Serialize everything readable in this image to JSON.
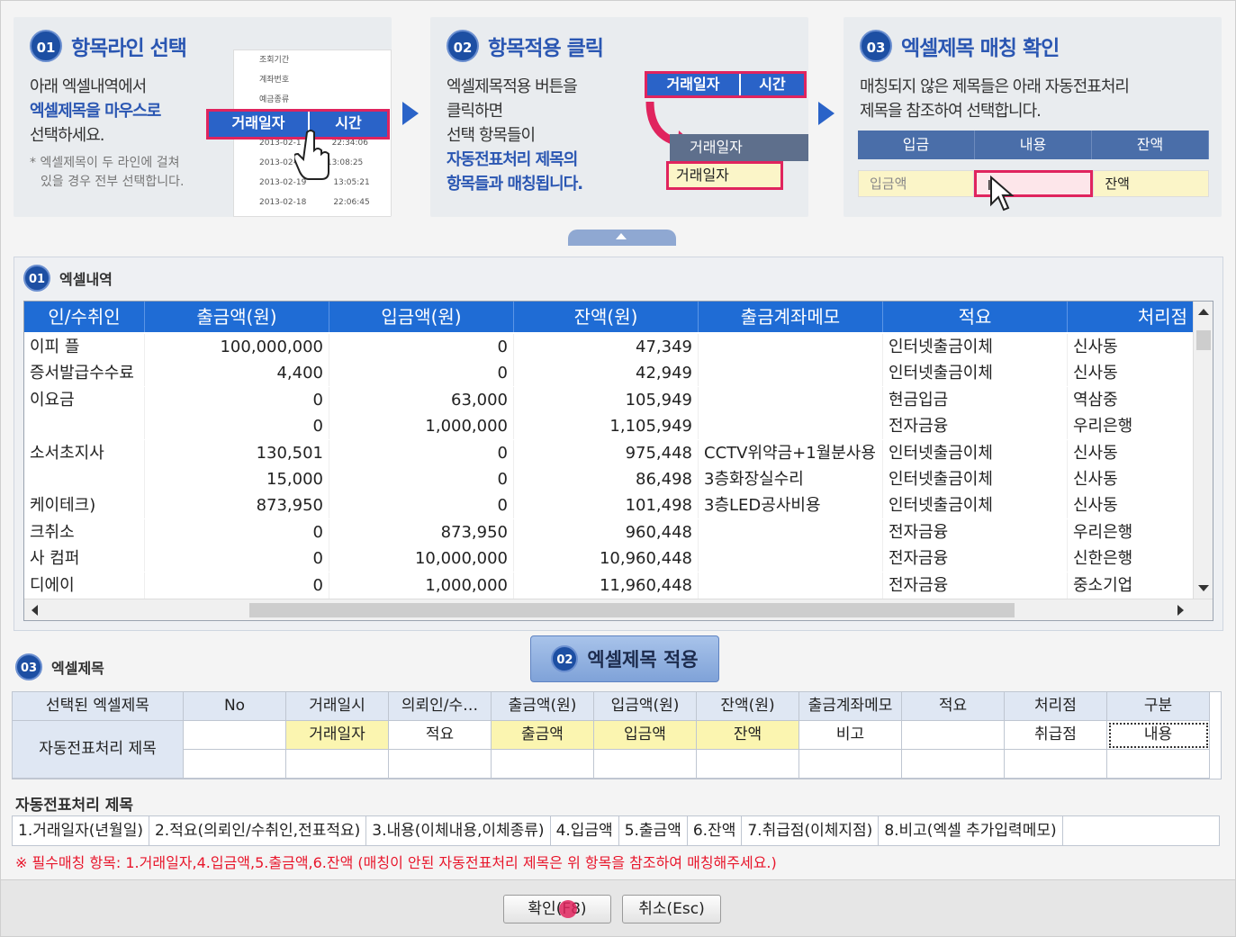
{
  "steps": [
    {
      "num": "01",
      "title": "항목라인 선택",
      "lines": [
        "아래 엑셀내역에서",
        "엑셀제목을 마우스로",
        "선택하세요."
      ],
      "note": [
        "* 엑셀제목이 두 라인에 걸쳐",
        "있을 경우 전부 선택합니다."
      ],
      "bar": [
        "거래일자",
        "시간"
      ],
      "mini": [
        "조회기간",
        "계좌번호",
        "예금종류",
        "2013-02-1",
        "2013-02-",
        "2013-02-19",
        "2013-02-18"
      ],
      "mini_right": [
        "22:34:06",
        "13:08:25",
        "13:05:21",
        "22:06:45"
      ]
    },
    {
      "num": "02",
      "title": "항목적용 클릭",
      "lines": [
        "엑셀제목적용 버튼을",
        "클릭하면",
        "선택 항목들이",
        "자동전표처리 제목의",
        "항목들과 매칭됩니다."
      ],
      "bar": [
        "거래일자",
        "시간"
      ],
      "target": "거래일자",
      "target_val": "거래일자"
    },
    {
      "num": "03",
      "title": "엑셀제목 매칭 확인",
      "lines": [
        "매칭되지 않은 제목들은 아래 자동전표처리",
        "제목을 참조하여 선택합니다."
      ],
      "hdr": [
        "입금",
        "내용",
        "잔액"
      ],
      "row": [
        "입금액",
        "I",
        "잔액"
      ]
    }
  ],
  "grid": {
    "section_label": "엑셀내역",
    "badge": "01",
    "columns": [
      "인/수취인",
      "출금액(원)",
      "입금액(원)",
      "잔액(원)",
      "출금계좌메모",
      "적요",
      "처리점"
    ],
    "rows": [
      [
        "이피   플",
        "100,000,000",
        "0",
        "47,349",
        "",
        "인터넷출금이체",
        "신사동"
      ],
      [
        "증서발급수수료",
        "4,400",
        "0",
        "42,949",
        "",
        "인터넷출금이체",
        "신사동"
      ],
      [
        "이요금",
        "0",
        "63,000",
        "105,949",
        "",
        "현금입금",
        "역삼중"
      ],
      [
        "",
        "0",
        "1,000,000",
        "1,105,949",
        "",
        "전자금융",
        "우리은행"
      ],
      [
        "소서초지사",
        "130,501",
        "0",
        "975,448",
        "CCTV위약금+1월분사용",
        "인터넷출금이체",
        "신사동"
      ],
      [
        "",
        "15,000",
        "0",
        "86,498",
        "3층화장실수리",
        "인터넷출금이체",
        "신사동"
      ],
      [
        "케이테크)",
        "873,950",
        "0",
        "101,498",
        "3층LED공사비용",
        "인터넷출금이체",
        "신사동"
      ],
      [
        "크취소",
        "0",
        "873,950",
        "960,448",
        "",
        "전자금융",
        "우리은행"
      ],
      [
        "사   컴퍼",
        "0",
        "10,000,000",
        "10,960,448",
        "",
        "전자금융",
        "신한은행"
      ],
      [
        "디에이",
        "0",
        "1,000,000",
        "11,960,448",
        "",
        "전자금융",
        "중소기업"
      ]
    ]
  },
  "apply_button": {
    "badge": "02",
    "label": "엑셀제목 적용"
  },
  "mapping": {
    "section_label": "엑셀제목",
    "badge": "03",
    "row1_label": "선택된 엑셀제목",
    "row2_label": "자동전표처리 제목",
    "headers": [
      "No",
      "거래일시",
      "의뢰인/수…",
      "출금액(원)",
      "입금액(원)",
      "잔액(원)",
      "출금계좌메모",
      "적요",
      "처리점",
      "구분"
    ],
    "values": [
      "",
      "거래일자",
      "적요",
      "출금액",
      "입금액",
      "잔액",
      "비고",
      "",
      "취급점",
      "내용"
    ]
  },
  "reference": {
    "label": "자동전표처리 제목",
    "items": [
      "1.거래일자(년월일)",
      "2.적요(의뢰인/수취인,전표적요)",
      "3.내용(이체내용,이체종류)",
      "4.입금액",
      "5.출금액",
      "6.잔액",
      "7.취급점(이체지점)",
      "8.비고(엑셀 추가입력메모)"
    ]
  },
  "notice": "※ 필수매칭 항목: 1.거래일자,4.입금액,5.출금액,6.잔액  (매칭이 안된 자동전표처리 제목은 위 항목을 참조하여 매칭해주세요.)",
  "footer": {
    "ok": "확인(F8)",
    "cancel": "취소(Esc)"
  },
  "colors": {
    "accent": "#1f6cd5",
    "highlight": "#e0245e",
    "match_yellow": "#fbf5b0",
    "notice_red": "#e8162b"
  }
}
